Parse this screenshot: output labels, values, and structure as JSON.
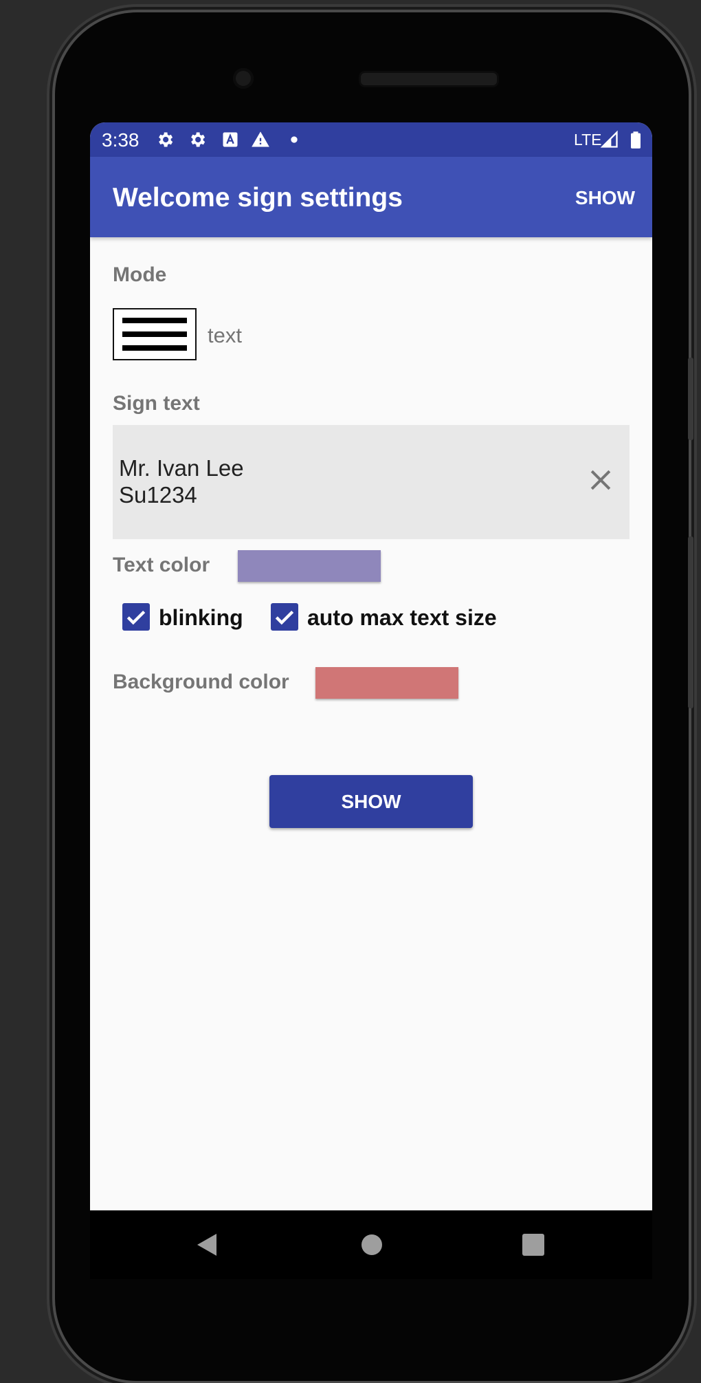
{
  "status_bar": {
    "time": "3:38",
    "network": "LTE",
    "icons": [
      "settings-icon",
      "settings-icon",
      "accessibility-notification-icon",
      "warning-icon",
      "dot-icon",
      "signal-icon",
      "battery-icon"
    ]
  },
  "app_bar": {
    "title": "Welcome sign settings",
    "action_label": "SHOW"
  },
  "mode": {
    "label": "Mode",
    "value": "text",
    "icon": "text-lines-icon"
  },
  "sign_text": {
    "label": "Sign text",
    "line1": "Mr. Ivan Lee",
    "line2": "Su1234"
  },
  "text_color": {
    "label": "Text color",
    "color": "#8f87bb"
  },
  "options": {
    "blinking_label": "blinking",
    "blinking_checked": true,
    "auto_size_label": "auto max text size",
    "auto_size_checked": true
  },
  "background_color": {
    "label": "Background color",
    "color": "#d07676"
  },
  "show_button": {
    "label": "SHOW"
  },
  "colors": {
    "status_bar": "#303f9f",
    "app_bar": "#3f51b5",
    "primary_dark": "#303f9f"
  }
}
